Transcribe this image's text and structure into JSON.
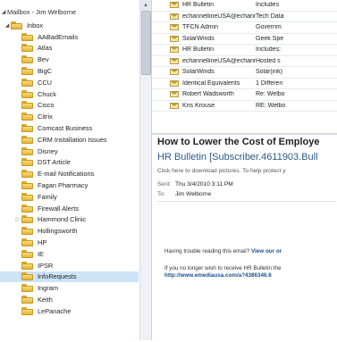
{
  "folder_pane": {
    "mailbox_label": "Mailbox - Jim Welborne",
    "inbox_label": "Inbox",
    "folders": [
      {
        "label": "AABadEmails"
      },
      {
        "label": "Atlas"
      },
      {
        "label": "Bev"
      },
      {
        "label": "BigC"
      },
      {
        "label": "CCU"
      },
      {
        "label": "Chuck"
      },
      {
        "label": "Cisco"
      },
      {
        "label": "Citrix"
      },
      {
        "label": "Comcast Business"
      },
      {
        "label": "CRM Installation Issues"
      },
      {
        "label": "Disney"
      },
      {
        "label": "DST Article"
      },
      {
        "label": "E-mail Notifications"
      },
      {
        "label": "Fagan Pharmacy"
      },
      {
        "label": "Family"
      },
      {
        "label": "Firewall Alerts"
      },
      {
        "label": "Hammond Clinic"
      },
      {
        "label": "Hollingsworth"
      },
      {
        "label": "HP"
      },
      {
        "label": "IE"
      },
      {
        "label": "IPSR"
      },
      {
        "label": "InfoRequests",
        "selected": true
      },
      {
        "label": "Ingram"
      },
      {
        "label": "Keith"
      },
      {
        "label": "LePanache"
      }
    ]
  },
  "message_list": {
    "rows": [
      {
        "sender": "HR Bulletin",
        "subject": "Includes"
      },
      {
        "sender": "echannellineUSA@echann...",
        "subject": "Tech Data"
      },
      {
        "sender": "TFCN Admin",
        "subject": "Governm"
      },
      {
        "sender": "SolarWinds",
        "subject": "Geek Spe"
      },
      {
        "sender": "HR Bulletin",
        "subject": "Includes:"
      },
      {
        "sender": "echannellineUSA@echann...",
        "subject": "Hosted s"
      },
      {
        "sender": "SolarWinds",
        "subject": "Solar(ink)"
      },
      {
        "sender": "Identical Equivalents",
        "subject": "1 Differen"
      },
      {
        "sender": "Robert Wadsworth",
        "subject": "Re: Welbo"
      },
      {
        "sender": "Kris Krouse",
        "subject": "RE: Welbo"
      }
    ]
  },
  "reading_pane": {
    "title": "How to Lower the Cost of Employe",
    "subtitle": "HR Bulletin [Subscriber.4611903.Bull",
    "pictures_notice": "Click here to download pictures. To help protect y",
    "sent_label": "Sent:",
    "sent_value": "Thu 3/4/2010 3:11 PM",
    "to_label": "To:",
    "to_value": "Jim Welborne",
    "body_line1": "Having trouble reading this email?",
    "body_line1_link": "View our or",
    "body_line2": "If you no longer wish to receive HR Bulletin the",
    "body_line3": "http://www.emediausa.com/a?4386346.6"
  }
}
